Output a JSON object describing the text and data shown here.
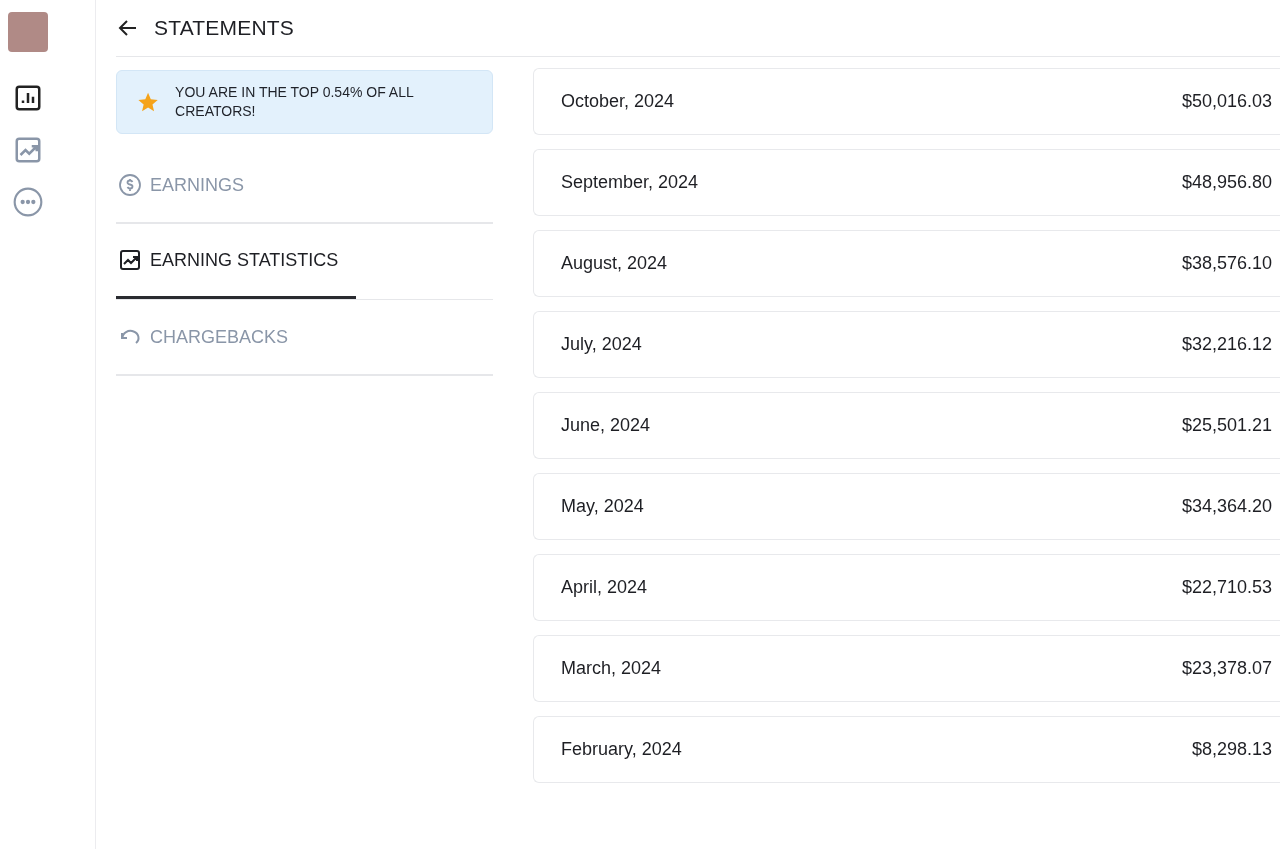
{
  "rail": {
    "items": [
      {
        "kind": "statistics",
        "selected": true
      },
      {
        "kind": "trend",
        "selected": false
      },
      {
        "kind": "more",
        "selected": false
      }
    ]
  },
  "header": {
    "title": "STATEMENTS"
  },
  "banner": {
    "text": "YOU ARE IN THE TOP 0.54% OF ALL CREATORS!"
  },
  "tabs": [
    {
      "label": "EARNINGS",
      "kind": "earnings",
      "selected": false
    },
    {
      "label": "EARNING STATISTICS",
      "kind": "statistics",
      "selected": true
    },
    {
      "label": "CHARGEBACKS",
      "kind": "chargebacks",
      "selected": false
    }
  ],
  "statements": [
    {
      "month": "October, 2024",
      "amount": "$50,016.03"
    },
    {
      "month": "September, 2024",
      "amount": "$48,956.80"
    },
    {
      "month": "August, 2024",
      "amount": "$38,576.10"
    },
    {
      "month": "July, 2024",
      "amount": "$32,216.12"
    },
    {
      "month": "June, 2024",
      "amount": "$25,501.21"
    },
    {
      "month": "May, 2024",
      "amount": "$34,364.20"
    },
    {
      "month": "April, 2024",
      "amount": "$22,710.53"
    },
    {
      "month": "March, 2024",
      "amount": "$23,378.07"
    },
    {
      "month": "February, 2024",
      "amount": "$8,298.13"
    }
  ]
}
